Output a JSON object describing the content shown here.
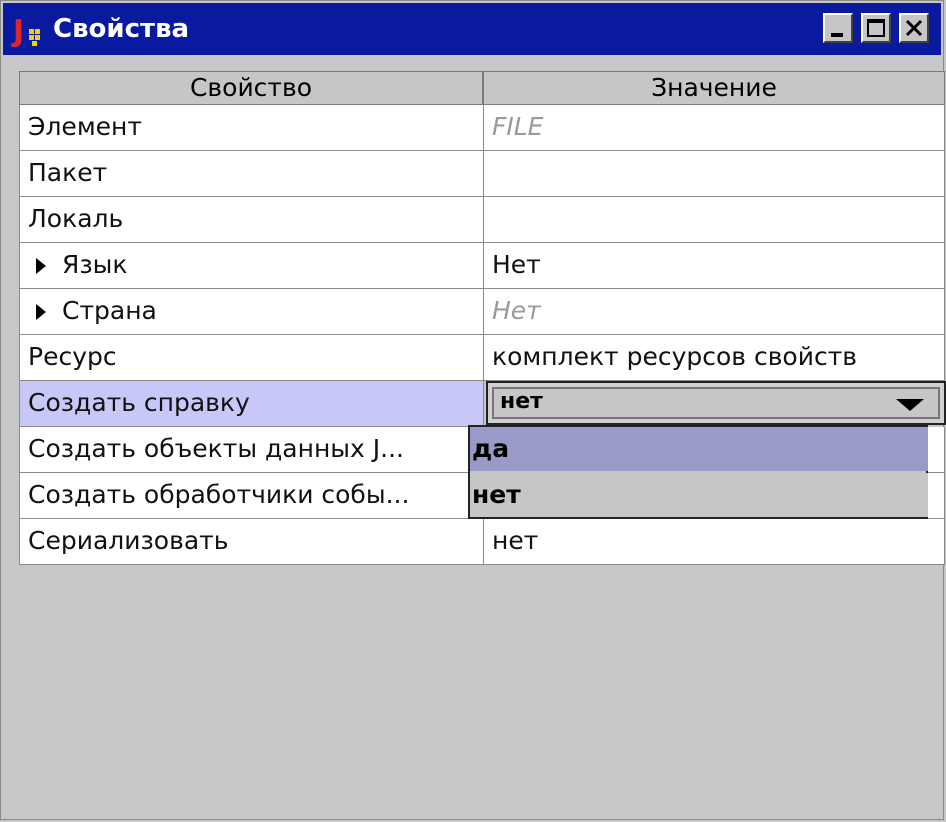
{
  "window": {
    "title": "Свойства",
    "icon": "java-bean-icon",
    "titlebar_color": "#0a1aa0",
    "controls": [
      "minimize-icon",
      "maximize-icon",
      "close-icon"
    ]
  },
  "table": {
    "headers": {
      "property": "Свойство",
      "value": "Значение"
    },
    "rows": [
      {
        "property": "Элемент",
        "value": "FILE",
        "value_style": "italic"
      },
      {
        "property": "Пакет",
        "value": ""
      },
      {
        "property": "Локаль",
        "value": ""
      },
      {
        "property": "Язык",
        "value": "Нет",
        "expandable": true
      },
      {
        "property": "Страна",
        "value": "Нет",
        "expandable": true,
        "value_style": "italic"
      },
      {
        "property": "Ресурс",
        "value": "комплект ресурсов свойств"
      },
      {
        "property": "Создать справку",
        "value": "нет",
        "selected": true,
        "editor": "combo"
      },
      {
        "property": "Создать объекты данных J..."
      },
      {
        "property": "Создать обработчики собы..."
      },
      {
        "property": "Сериализовать",
        "value": "нет"
      }
    ]
  },
  "dropdown": {
    "options": [
      "да",
      "нет"
    ],
    "highlighted": "да",
    "highlight_color": "#9a9ac8"
  },
  "colors": {
    "selected_row": "#c8c8f8",
    "background": "#c6c6c6"
  }
}
